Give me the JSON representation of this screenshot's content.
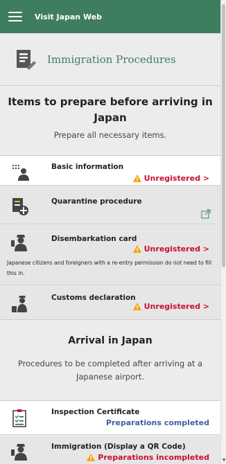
{
  "header": {
    "title": "Visit Japan Web"
  },
  "page": {
    "title": "Immigration Procedures"
  },
  "prepare": {
    "title": "Items to prepare before arriving in Japan",
    "subtitle": "Prepare all necessary items."
  },
  "items": [
    {
      "label": "Basic information",
      "status": "Unregistered >"
    },
    {
      "label": "Quarantine procedure"
    },
    {
      "label": "Disembarkation card",
      "status": "Unregistered >",
      "note": "Japanese citizens and foreigners with a re-entry permission do not need to fill this in."
    },
    {
      "label": "Customs declaration",
      "status": "Unregistered >"
    }
  ],
  "arrival": {
    "title": "Arrival in Japan",
    "subtitle": "Procedures to be completed after arriving at a Japanese airport."
  },
  "arrival_items": [
    {
      "label": "Inspection Certificate",
      "status": "Preparations completed"
    },
    {
      "label": "Immigration (Display a QR Code)",
      "status": "Preparations incompleted"
    }
  ],
  "colors": {
    "brand": "#3f7d5f",
    "alert": "#c8102e",
    "warning": "#f0a500",
    "complete": "#3a5fa8"
  },
  "icons": [
    "menu-icon",
    "document-icon",
    "id-card-icon",
    "quarantine-icon",
    "officer-icon",
    "customs-icon",
    "external-link-icon",
    "checklist-icon",
    "warning-icon"
  ]
}
